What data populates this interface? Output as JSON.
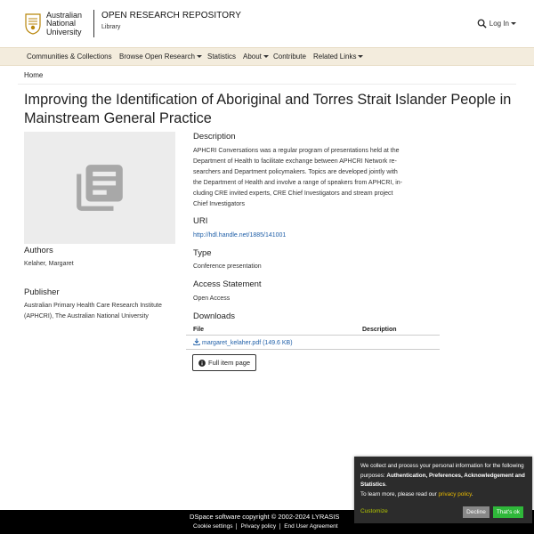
{
  "header": {
    "logo_lines": [
      "Australian",
      "National",
      "University"
    ],
    "repo_title": "OPEN RESEARCH REPOSITORY",
    "repo_subtitle": "Library",
    "login_label": "Log In"
  },
  "nav": {
    "items": [
      {
        "label": "Communities & Collections",
        "dropdown": false
      },
      {
        "label": "Browse Open Research",
        "dropdown": true
      },
      {
        "label": "Statistics",
        "dropdown": false
      },
      {
        "label": "About",
        "dropdown": true
      },
      {
        "label": "Contribute",
        "dropdown": false
      },
      {
        "label": "Related Links",
        "dropdown": true
      }
    ]
  },
  "breadcrumb": "Home",
  "item": {
    "title": "Improving the Identification of Aboriginal and Torres Strait Islander People in Mainstream General Practice",
    "authors_label": "Authors",
    "authors_value": "Kelaher, Margaret",
    "publisher_label": "Publisher",
    "publisher_value": "Australian Primary Health Care Research Institute (APHCRI), The Australian National University",
    "description_label": "Description",
    "description_lines": [
      "APHCRI Conversations was a regular program of presentations held at the",
      "Department of Health to facilitate exchange between APHCRI Network re-",
      "searchers and Department policymakers. Topics are developed jointly with",
      "the Department of Health and involve a range of speakers from APHCRI, in-",
      "cluding CRE invited experts, CRE Chief Investigators and stream project",
      "Chief Investigators"
    ],
    "uri_label": "URI",
    "uri_value": "http://hdl.handle.net/1885/141001",
    "type_label": "Type",
    "type_value": "Conference presentation",
    "access_label": "Access Statement",
    "access_value": "Open Access",
    "downloads_label": "Downloads",
    "downloads_cols": {
      "file": "File",
      "description": "Description"
    },
    "downloads_files": [
      {
        "name": "margaret_kelaher.pdf (149.6 KB)",
        "description": ""
      }
    ],
    "full_item_label": "Full item page"
  },
  "footer": {
    "copyright": "DSpace software copyright © 2002-2024 LYRASIS",
    "links": [
      "Cookie settings",
      "Privacy policy",
      "End User Agreement"
    ]
  },
  "cookie": {
    "text_1": "We collect and process your personal information for the following purposes: ",
    "text_bold": "Authentication, Preferences, Acknowledgement and Statistics",
    "text_2": ".",
    "text_3": "To learn more, please read our ",
    "policy_link": "privacy policy",
    "text_4": ".",
    "customize": "Customize",
    "decline": "Decline",
    "ok": "That's ok"
  },
  "colors": {
    "nav_bg": "#f3ecdd",
    "link": "#1f5fa8",
    "footer_bg": "#000000",
    "cookie_bg": "#2c2c2c",
    "ok_button": "#2fb83a"
  }
}
